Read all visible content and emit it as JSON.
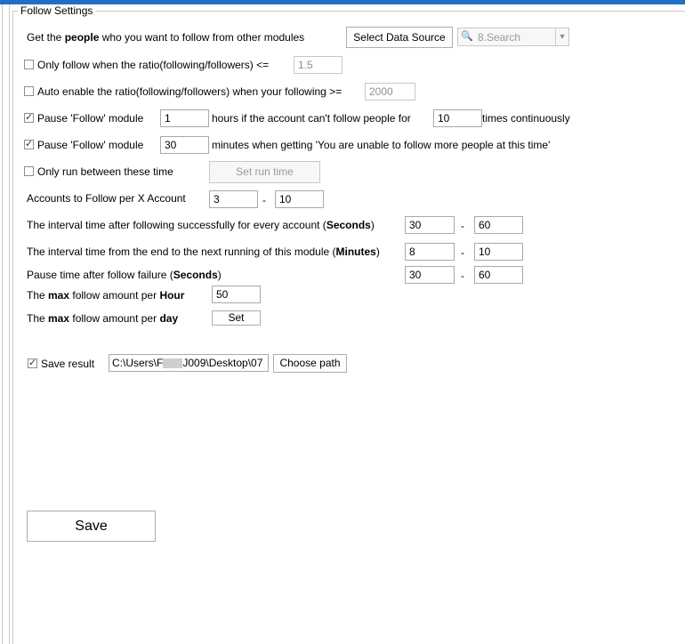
{
  "group_title": "Follow Settings",
  "data_source": {
    "label_pre": "Get the",
    "label_bold": "people",
    "label_post": " who you want to follow from other modules",
    "button_label": "Select Data Source",
    "dropdown_value": "8.Search"
  },
  "ratio_max": {
    "label": "Only follow when the ratio(following/followers) <=",
    "value": "1.5",
    "checked": false
  },
  "ratio_auto": {
    "label": "Auto enable the ratio(following/followers) when your following >=",
    "value": "2000",
    "checked": false
  },
  "pause_fail": {
    "label": "Pause 'Follow' module",
    "hours_value": "1",
    "mid_label": "hours if the account can't follow people for",
    "times_value": "10",
    "post_label": "times continuously",
    "checked": true
  },
  "pause_limit": {
    "label": "Pause 'Follow' module",
    "minutes_value": "30",
    "post_label": "minutes when getting 'You are unable to follow more people at this time'",
    "checked": true
  },
  "run_time": {
    "label": "Only run between these time",
    "button_label": "Set run time",
    "checked": false
  },
  "accounts_per_x": {
    "label": "Accounts to Follow per X Account",
    "min": "3",
    "max": "10",
    "sep": "-"
  },
  "interval_success": {
    "label_pre": "The interval time after following successfully for every account (",
    "label_bold": "Seconds",
    "label_post": ")",
    "min": "30",
    "max": "60",
    "sep": "-"
  },
  "interval_next": {
    "label_pre": "The interval time from the end to the next running of this module (",
    "label_bold": "Minutes",
    "label_post": ")",
    "min": "8",
    "max": "10",
    "sep": "-"
  },
  "pause_failure": {
    "label_pre": "Pause time after follow failure (",
    "label_bold": "Seconds",
    "label_post": ")",
    "min": "30",
    "max": "60",
    "sep": "-"
  },
  "max_hour": {
    "label_pre": "The ",
    "label_bold1": "max",
    "label_mid": " follow amount per ",
    "label_bold2": "Hour",
    "value": "50"
  },
  "max_day": {
    "label_pre": "The ",
    "label_bold1": "max",
    "label_mid": " follow amount per ",
    "label_bold2": "day",
    "button_label": "Set"
  },
  "save_result": {
    "label": "Save result",
    "path_pre": "C:\\Users\\F",
    "path_post": "J009\\Desktop\\07",
    "button_label": "Choose path",
    "checked": true
  },
  "save_button": "Save",
  "check_glyph": "✓",
  "search_icon_glyph": "🔍",
  "dropdown_arrow_glyph": "▾",
  "accent_color": "#1f6fc5"
}
